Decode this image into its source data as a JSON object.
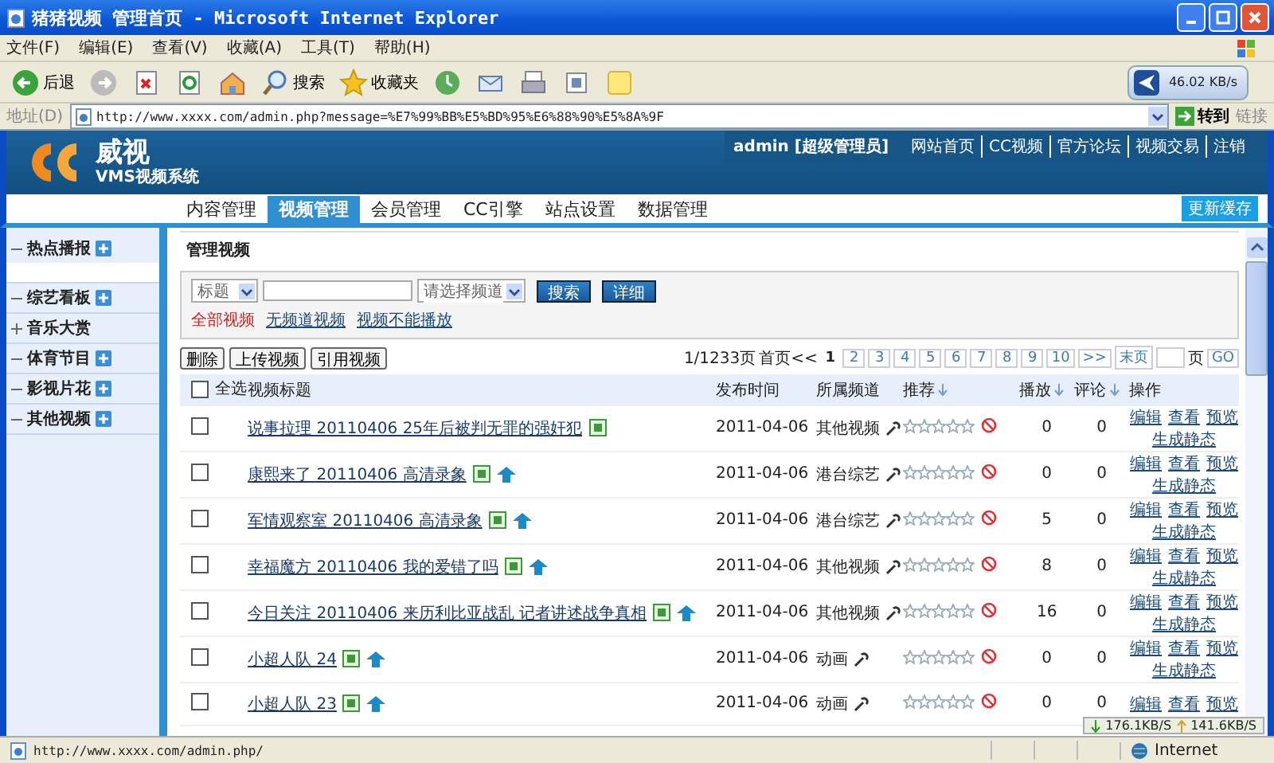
{
  "window": {
    "title": "猪猪视频 管理首页 - Microsoft Internet Explorer"
  },
  "menu": [
    "文件(F)",
    "编辑(E)",
    "查看(V)",
    "收藏(A)",
    "工具(T)",
    "帮助(H)"
  ],
  "toolbar": [
    {
      "kind": "back",
      "label": "后退"
    },
    {
      "kind": "forward"
    },
    {
      "kind": "stop"
    },
    {
      "kind": "refresh"
    },
    {
      "kind": "home"
    },
    {
      "kind": "search",
      "label": "搜索"
    },
    {
      "kind": "favorites",
      "label": "收藏夹"
    },
    {
      "kind": "history"
    },
    {
      "kind": "mail"
    },
    {
      "kind": "print"
    },
    {
      "kind": "edit"
    },
    {
      "kind": "note"
    }
  ],
  "speed_widget": {
    "reading": "46.02 KB/s"
  },
  "address_bar": {
    "label": "地址(D)",
    "value": "http://www.xxxx.com/admin.php?message=%E7%99%BB%E5%BD%95%E6%88%90%E5%8A%9F",
    "go": "转到",
    "links": "链接"
  },
  "site": {
    "logo": "威视",
    "subtitle": "VMS视频系统",
    "user": "admin [超级管理员]",
    "links": [
      "网站首页",
      "CC视频",
      "官方论坛",
      "视频交易",
      "注销"
    ]
  },
  "nav": {
    "tabs": [
      {
        "label": "内容管理",
        "selected": false
      },
      {
        "label": "视频管理",
        "selected": true
      },
      {
        "label": "会员管理",
        "selected": false
      },
      {
        "label": "CC引擎",
        "selected": false
      },
      {
        "label": "站点设置",
        "selected": false
      },
      {
        "label": "数据管理",
        "selected": false
      }
    ],
    "refresh_button": "更新缓存"
  },
  "sidebar": {
    "items": [
      {
        "label": "热点播报",
        "expanded": true,
        "add": true
      },
      {
        "label": "综艺看板",
        "expanded": true,
        "add": true
      },
      {
        "label": "音乐大赏",
        "expanded": false,
        "add": false
      },
      {
        "label": "体育节目",
        "expanded": true,
        "add": true
      },
      {
        "label": "影视片花",
        "expanded": true,
        "add": true
      },
      {
        "label": "其他视频",
        "expanded": true,
        "add": true
      }
    ]
  },
  "main": {
    "heading": "管理视频",
    "filter": {
      "field_select": "标题",
      "channel_select": "请选择频道",
      "search_button": "搜索",
      "detail_button": "详细",
      "views": [
        {
          "label": "全部视频",
          "selected": true
        },
        {
          "label": "无频道视频",
          "selected": false
        },
        {
          "label": "视频不能播放",
          "selected": false
        }
      ]
    },
    "actions": [
      "删除",
      "上传视频",
      "引用视频"
    ],
    "pagination": {
      "summary": "1/1233页",
      "first": "首页<<",
      "pages": [
        {
          "label": "1",
          "selected": true
        },
        {
          "label": "2",
          "selected": false
        },
        {
          "label": "3",
          "selected": false
        },
        {
          "label": "4",
          "selected": false
        },
        {
          "label": "5",
          "selected": false
        },
        {
          "label": "6",
          "selected": false
        },
        {
          "label": "7",
          "selected": false
        },
        {
          "label": "8",
          "selected": false
        },
        {
          "label": "9",
          "selected": false
        },
        {
          "label": "10",
          "selected": false
        }
      ],
      "next": ">>",
      "last": "末页",
      "page_label": "页",
      "go": "GO"
    },
    "table": {
      "columns": [
        {
          "label": "全选",
          "kind": "check",
          "checked": false
        },
        {
          "label": "视频标题",
          "kind": "text"
        },
        {
          "label": "发布时间",
          "kind": "text"
        },
        {
          "label": "所属频道",
          "kind": "text"
        },
        {
          "label": "推荐",
          "kind": "sort"
        },
        {
          "label": "播放",
          "kind": "sort"
        },
        {
          "label": "评论",
          "kind": "sort"
        },
        {
          "label": "操作",
          "kind": "text"
        }
      ],
      "rows": [
        {
          "checked": false,
          "title": "说事拉理 20110406 25年后被判无罪的强奸犯",
          "promoted": false,
          "date": "2011-04-06",
          "channel": "其他视频",
          "stars": 0,
          "plays": "0",
          "comments": "0",
          "actions": [
            "编辑",
            "查看",
            "预览",
            "生成静态"
          ]
        },
        {
          "checked": false,
          "title": "康熙来了 20110406 高清录象",
          "promoted": true,
          "date": "2011-04-06",
          "channel": "港台综艺",
          "stars": 0,
          "plays": "0",
          "comments": "0",
          "actions": [
            "编辑",
            "查看",
            "预览",
            "生成静态"
          ]
        },
        {
          "checked": false,
          "title": "军情观察室 20110406 高清录象",
          "promoted": true,
          "date": "2011-04-06",
          "channel": "港台综艺",
          "stars": 0,
          "plays": "5",
          "comments": "0",
          "actions": [
            "编辑",
            "查看",
            "预览",
            "生成静态"
          ]
        },
        {
          "checked": false,
          "title": "幸福魔方 20110406 我的爱错了吗",
          "promoted": true,
          "date": "2011-04-06",
          "channel": "其他视频",
          "stars": 0,
          "plays": "8",
          "comments": "0",
          "actions": [
            "编辑",
            "查看",
            "预览",
            "生成静态"
          ]
        },
        {
          "checked": false,
          "title": "今日关注 20110406 来历利比亚战乱 记者讲述战争真相",
          "promoted": true,
          "date": "2011-04-06",
          "channel": "其他视频",
          "stars": 0,
          "plays": "16",
          "comments": "0",
          "actions": [
            "编辑",
            "查看",
            "预览",
            "生成静态"
          ]
        },
        {
          "checked": false,
          "title": "小超人队 24",
          "promoted": true,
          "date": "2011-04-06",
          "channel": "动画",
          "stars": 0,
          "plays": "0",
          "comments": "0",
          "actions": [
            "编辑",
            "查看",
            "预览",
            "生成静态"
          ]
        },
        {
          "checked": false,
          "title": "小超人队 23",
          "promoted": true,
          "date": "2011-04-06",
          "channel": "动画",
          "stars": 0,
          "plays": "0",
          "comments": "0",
          "actions": [
            "编辑",
            "查看",
            "预览"
          ]
        }
      ]
    }
  },
  "traffic": {
    "down": "176.1KB/S",
    "up": "141.6KB/S"
  },
  "status_bar": {
    "url": "http://www.xxxx.com/admin.php/",
    "zone": "Internet"
  }
}
